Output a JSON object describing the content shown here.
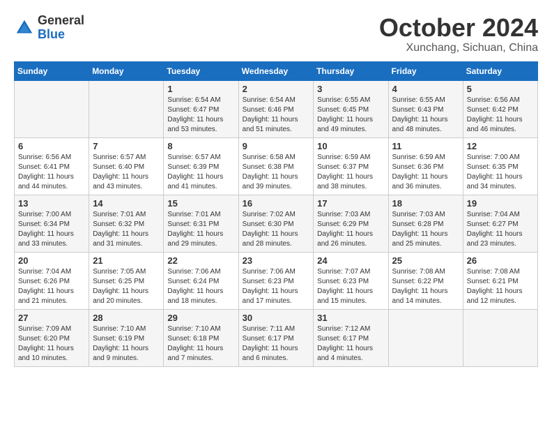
{
  "logo": {
    "general": "General",
    "blue": "Blue"
  },
  "title": "October 2024",
  "location": "Xunchang, Sichuan, China",
  "days_of_week": [
    "Sunday",
    "Monday",
    "Tuesday",
    "Wednesday",
    "Thursday",
    "Friday",
    "Saturday"
  ],
  "weeks": [
    [
      {
        "day": "",
        "info": ""
      },
      {
        "day": "",
        "info": ""
      },
      {
        "day": "1",
        "sunrise": "6:54 AM",
        "sunset": "6:47 PM",
        "daylight": "11 hours and 53 minutes."
      },
      {
        "day": "2",
        "sunrise": "6:54 AM",
        "sunset": "6:46 PM",
        "daylight": "11 hours and 51 minutes."
      },
      {
        "day": "3",
        "sunrise": "6:55 AM",
        "sunset": "6:45 PM",
        "daylight": "11 hours and 49 minutes."
      },
      {
        "day": "4",
        "sunrise": "6:55 AM",
        "sunset": "6:43 PM",
        "daylight": "11 hours and 48 minutes."
      },
      {
        "day": "5",
        "sunrise": "6:56 AM",
        "sunset": "6:42 PM",
        "daylight": "11 hours and 46 minutes."
      }
    ],
    [
      {
        "day": "6",
        "sunrise": "6:56 AM",
        "sunset": "6:41 PM",
        "daylight": "11 hours and 44 minutes."
      },
      {
        "day": "7",
        "sunrise": "6:57 AM",
        "sunset": "6:40 PM",
        "daylight": "11 hours and 43 minutes."
      },
      {
        "day": "8",
        "sunrise": "6:57 AM",
        "sunset": "6:39 PM",
        "daylight": "11 hours and 41 minutes."
      },
      {
        "day": "9",
        "sunrise": "6:58 AM",
        "sunset": "6:38 PM",
        "daylight": "11 hours and 39 minutes."
      },
      {
        "day": "10",
        "sunrise": "6:59 AM",
        "sunset": "6:37 PM",
        "daylight": "11 hours and 38 minutes."
      },
      {
        "day": "11",
        "sunrise": "6:59 AM",
        "sunset": "6:36 PM",
        "daylight": "11 hours and 36 minutes."
      },
      {
        "day": "12",
        "sunrise": "7:00 AM",
        "sunset": "6:35 PM",
        "daylight": "11 hours and 34 minutes."
      }
    ],
    [
      {
        "day": "13",
        "sunrise": "7:00 AM",
        "sunset": "6:34 PM",
        "daylight": "11 hours and 33 minutes."
      },
      {
        "day": "14",
        "sunrise": "7:01 AM",
        "sunset": "6:32 PM",
        "daylight": "11 hours and 31 minutes."
      },
      {
        "day": "15",
        "sunrise": "7:01 AM",
        "sunset": "6:31 PM",
        "daylight": "11 hours and 29 minutes."
      },
      {
        "day": "16",
        "sunrise": "7:02 AM",
        "sunset": "6:30 PM",
        "daylight": "11 hours and 28 minutes."
      },
      {
        "day": "17",
        "sunrise": "7:03 AM",
        "sunset": "6:29 PM",
        "daylight": "11 hours and 26 minutes."
      },
      {
        "day": "18",
        "sunrise": "7:03 AM",
        "sunset": "6:28 PM",
        "daylight": "11 hours and 25 minutes."
      },
      {
        "day": "19",
        "sunrise": "7:04 AM",
        "sunset": "6:27 PM",
        "daylight": "11 hours and 23 minutes."
      }
    ],
    [
      {
        "day": "20",
        "sunrise": "7:04 AM",
        "sunset": "6:26 PM",
        "daylight": "11 hours and 21 minutes."
      },
      {
        "day": "21",
        "sunrise": "7:05 AM",
        "sunset": "6:25 PM",
        "daylight": "11 hours and 20 minutes."
      },
      {
        "day": "22",
        "sunrise": "7:06 AM",
        "sunset": "6:24 PM",
        "daylight": "11 hours and 18 minutes."
      },
      {
        "day": "23",
        "sunrise": "7:06 AM",
        "sunset": "6:23 PM",
        "daylight": "11 hours and 17 minutes."
      },
      {
        "day": "24",
        "sunrise": "7:07 AM",
        "sunset": "6:23 PM",
        "daylight": "11 hours and 15 minutes."
      },
      {
        "day": "25",
        "sunrise": "7:08 AM",
        "sunset": "6:22 PM",
        "daylight": "11 hours and 14 minutes."
      },
      {
        "day": "26",
        "sunrise": "7:08 AM",
        "sunset": "6:21 PM",
        "daylight": "11 hours and 12 minutes."
      }
    ],
    [
      {
        "day": "27",
        "sunrise": "7:09 AM",
        "sunset": "6:20 PM",
        "daylight": "11 hours and 10 minutes."
      },
      {
        "day": "28",
        "sunrise": "7:10 AM",
        "sunset": "6:19 PM",
        "daylight": "11 hours and 9 minutes."
      },
      {
        "day": "29",
        "sunrise": "7:10 AM",
        "sunset": "6:18 PM",
        "daylight": "11 hours and 7 minutes."
      },
      {
        "day": "30",
        "sunrise": "7:11 AM",
        "sunset": "6:17 PM",
        "daylight": "11 hours and 6 minutes."
      },
      {
        "day": "31",
        "sunrise": "7:12 AM",
        "sunset": "6:17 PM",
        "daylight": "11 hours and 4 minutes."
      },
      {
        "day": "",
        "info": ""
      },
      {
        "day": "",
        "info": ""
      }
    ]
  ]
}
